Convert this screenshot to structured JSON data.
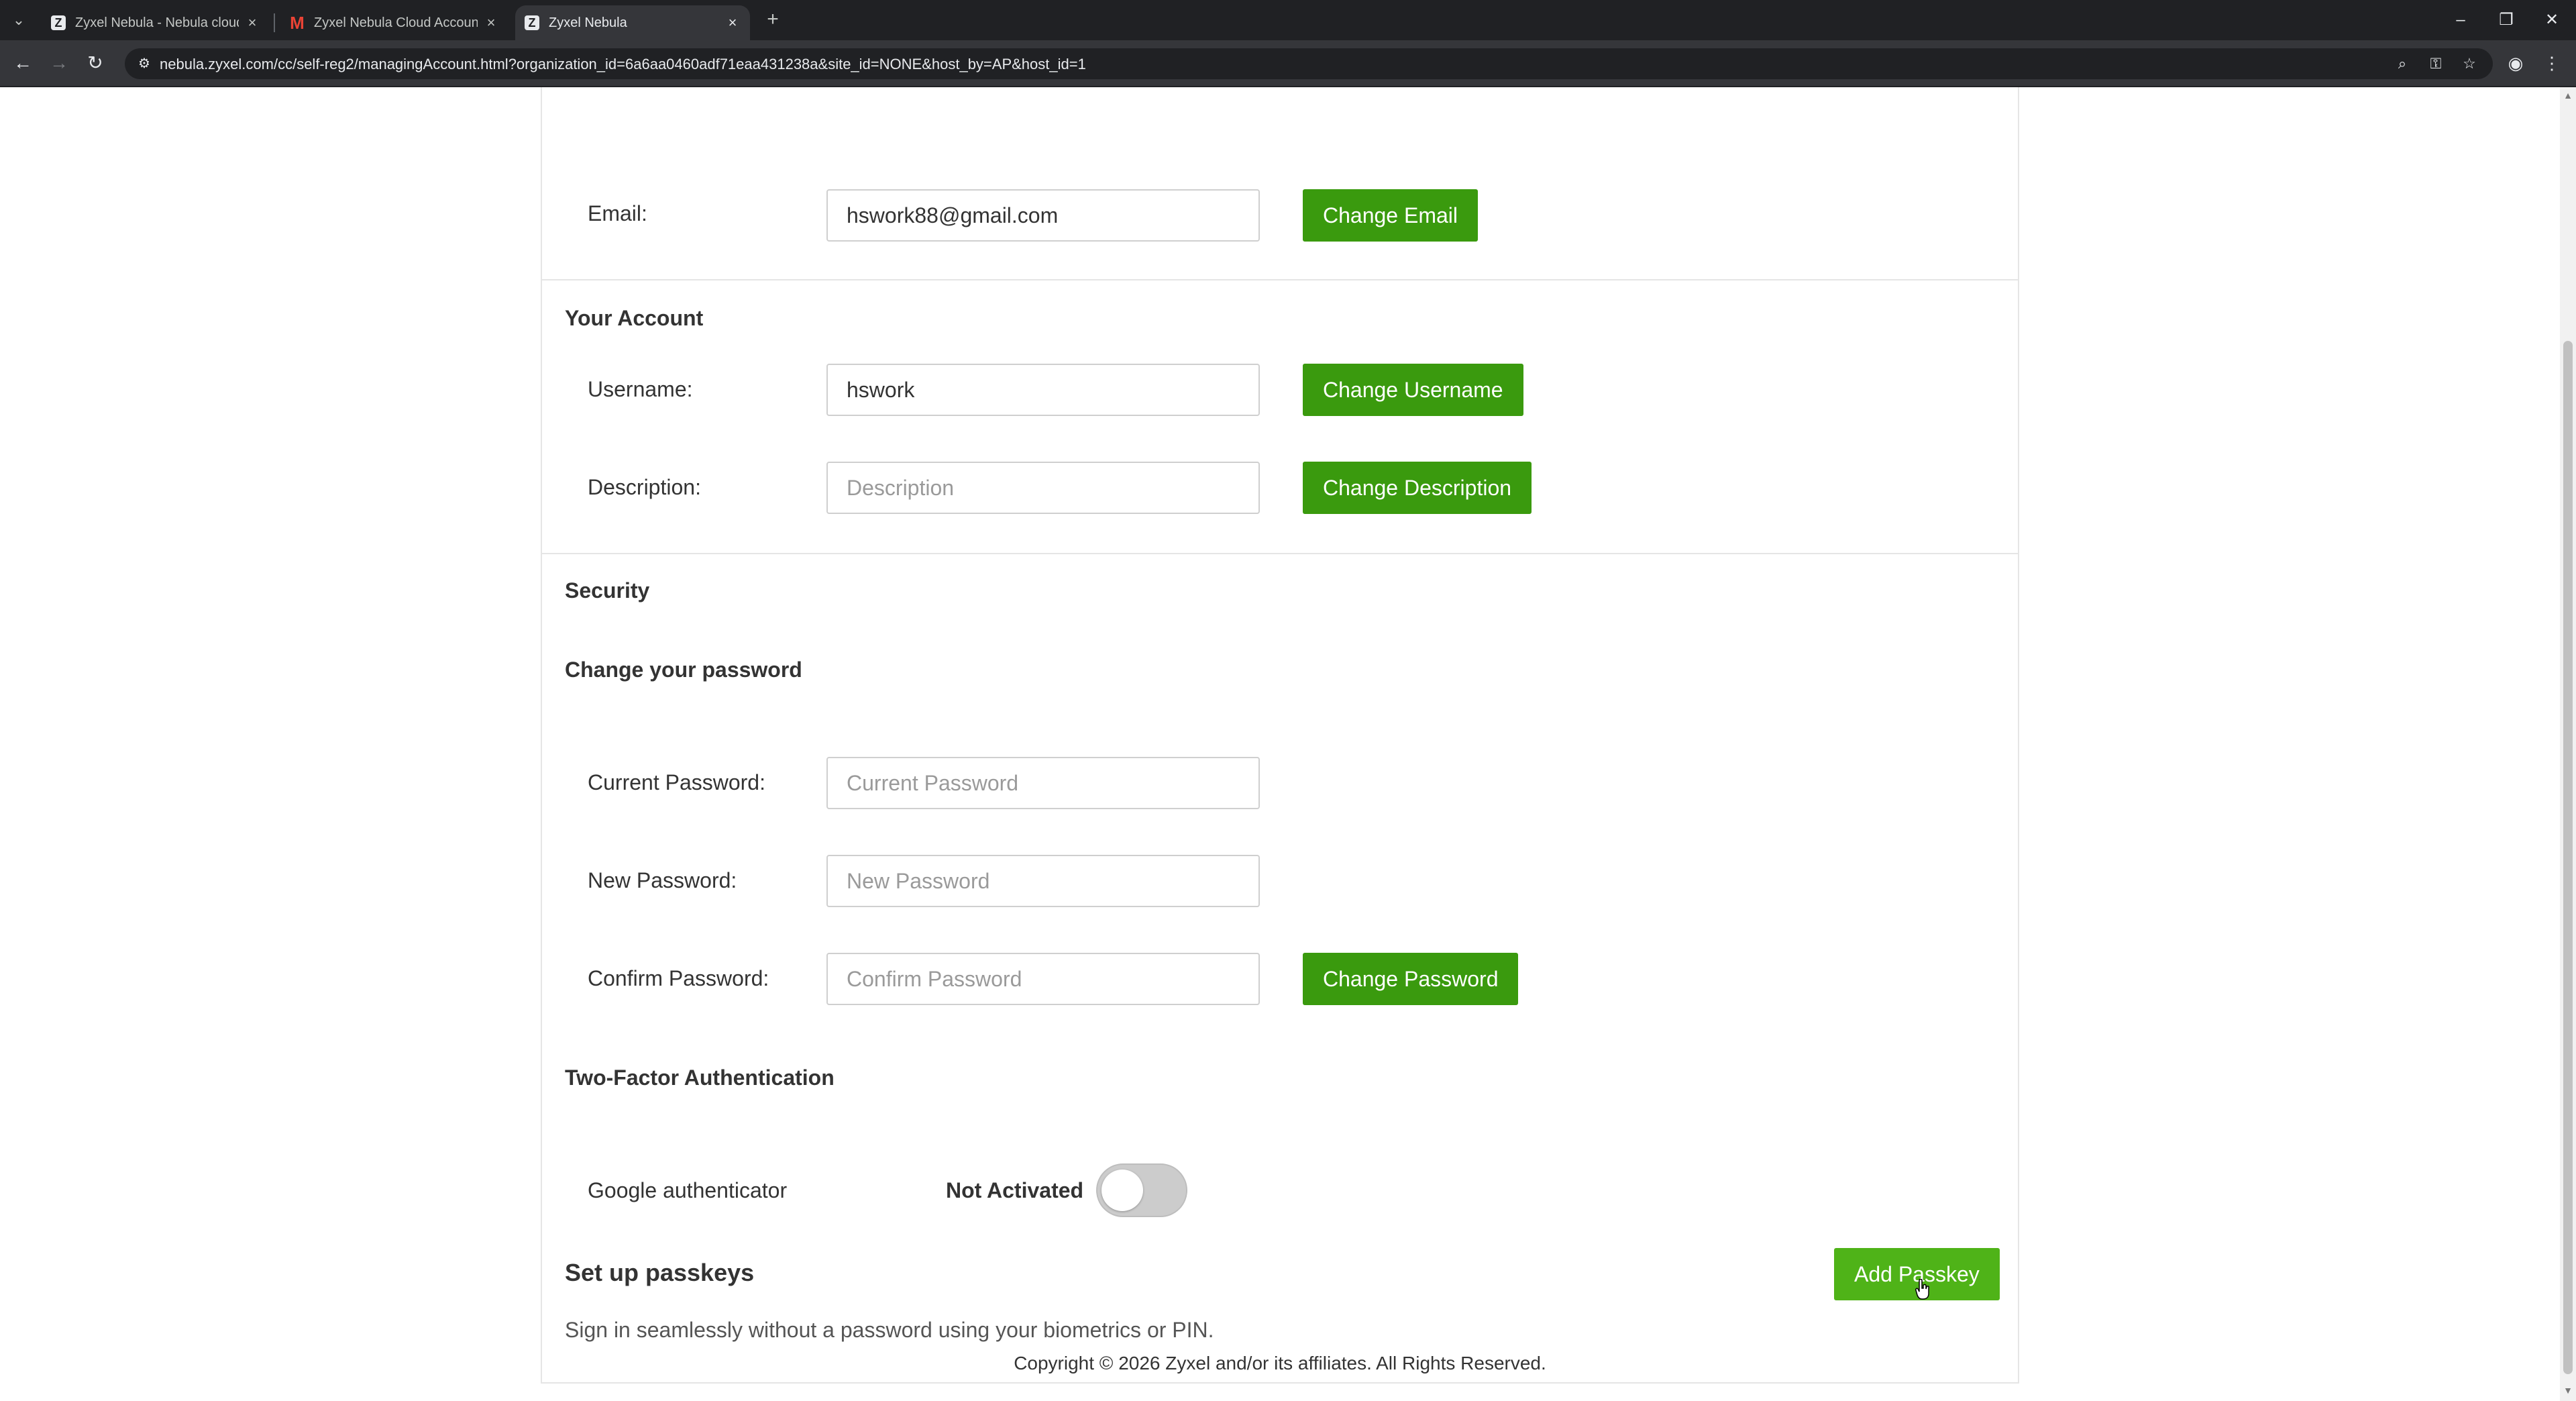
{
  "browser": {
    "tabs": [
      {
        "title": "Zyxel Nebula - Nebula cloud an",
        "favicon": "zyxel-icon"
      },
      {
        "title": "Zyxel Nebula Cloud Account In",
        "favicon": "gmail-icon"
      },
      {
        "title": "Zyxel Nebula",
        "favicon": "zyxel-icon",
        "active": true
      }
    ],
    "url": "nebula.zyxel.com/cc/self-reg2/managingAccount.html?organization_id=6a6aa0460adf71eaa431238a&site_id=NONE&host_by=AP&host_id=1"
  },
  "email": {
    "label": "Email:",
    "value": "hswork88@gmail.com",
    "button": "Change Email"
  },
  "account": {
    "title": "Your Account",
    "username_label": "Username:",
    "username_value": "hswork",
    "username_button": "Change Username",
    "description_label": "Description:",
    "description_placeholder": "Description",
    "description_button": "Change Description"
  },
  "security": {
    "title": "Security",
    "password_title": "Change your password",
    "current_label": "Current Password:",
    "current_placeholder": "Current Password",
    "new_label": "New Password:",
    "new_placeholder": "New Password",
    "confirm_label": "Confirm Password:",
    "confirm_placeholder": "Confirm Password",
    "password_button": "Change Password"
  },
  "two_factor": {
    "title": "Two-Factor Authentication",
    "label": "Google authenticator",
    "status": "Not Activated",
    "enabled": false
  },
  "passkeys": {
    "title": "Set up passkeys",
    "description": "Sign in seamlessly without a password using your biometrics or PIN.",
    "button": "Add Passkey"
  },
  "footer": {
    "copyright": "Copyright © 2026 Zyxel and/or its affiliates. All Rights Reserved."
  },
  "colors": {
    "button_green": "#3a9a0e",
    "button_green_hover": "#4fb318"
  }
}
